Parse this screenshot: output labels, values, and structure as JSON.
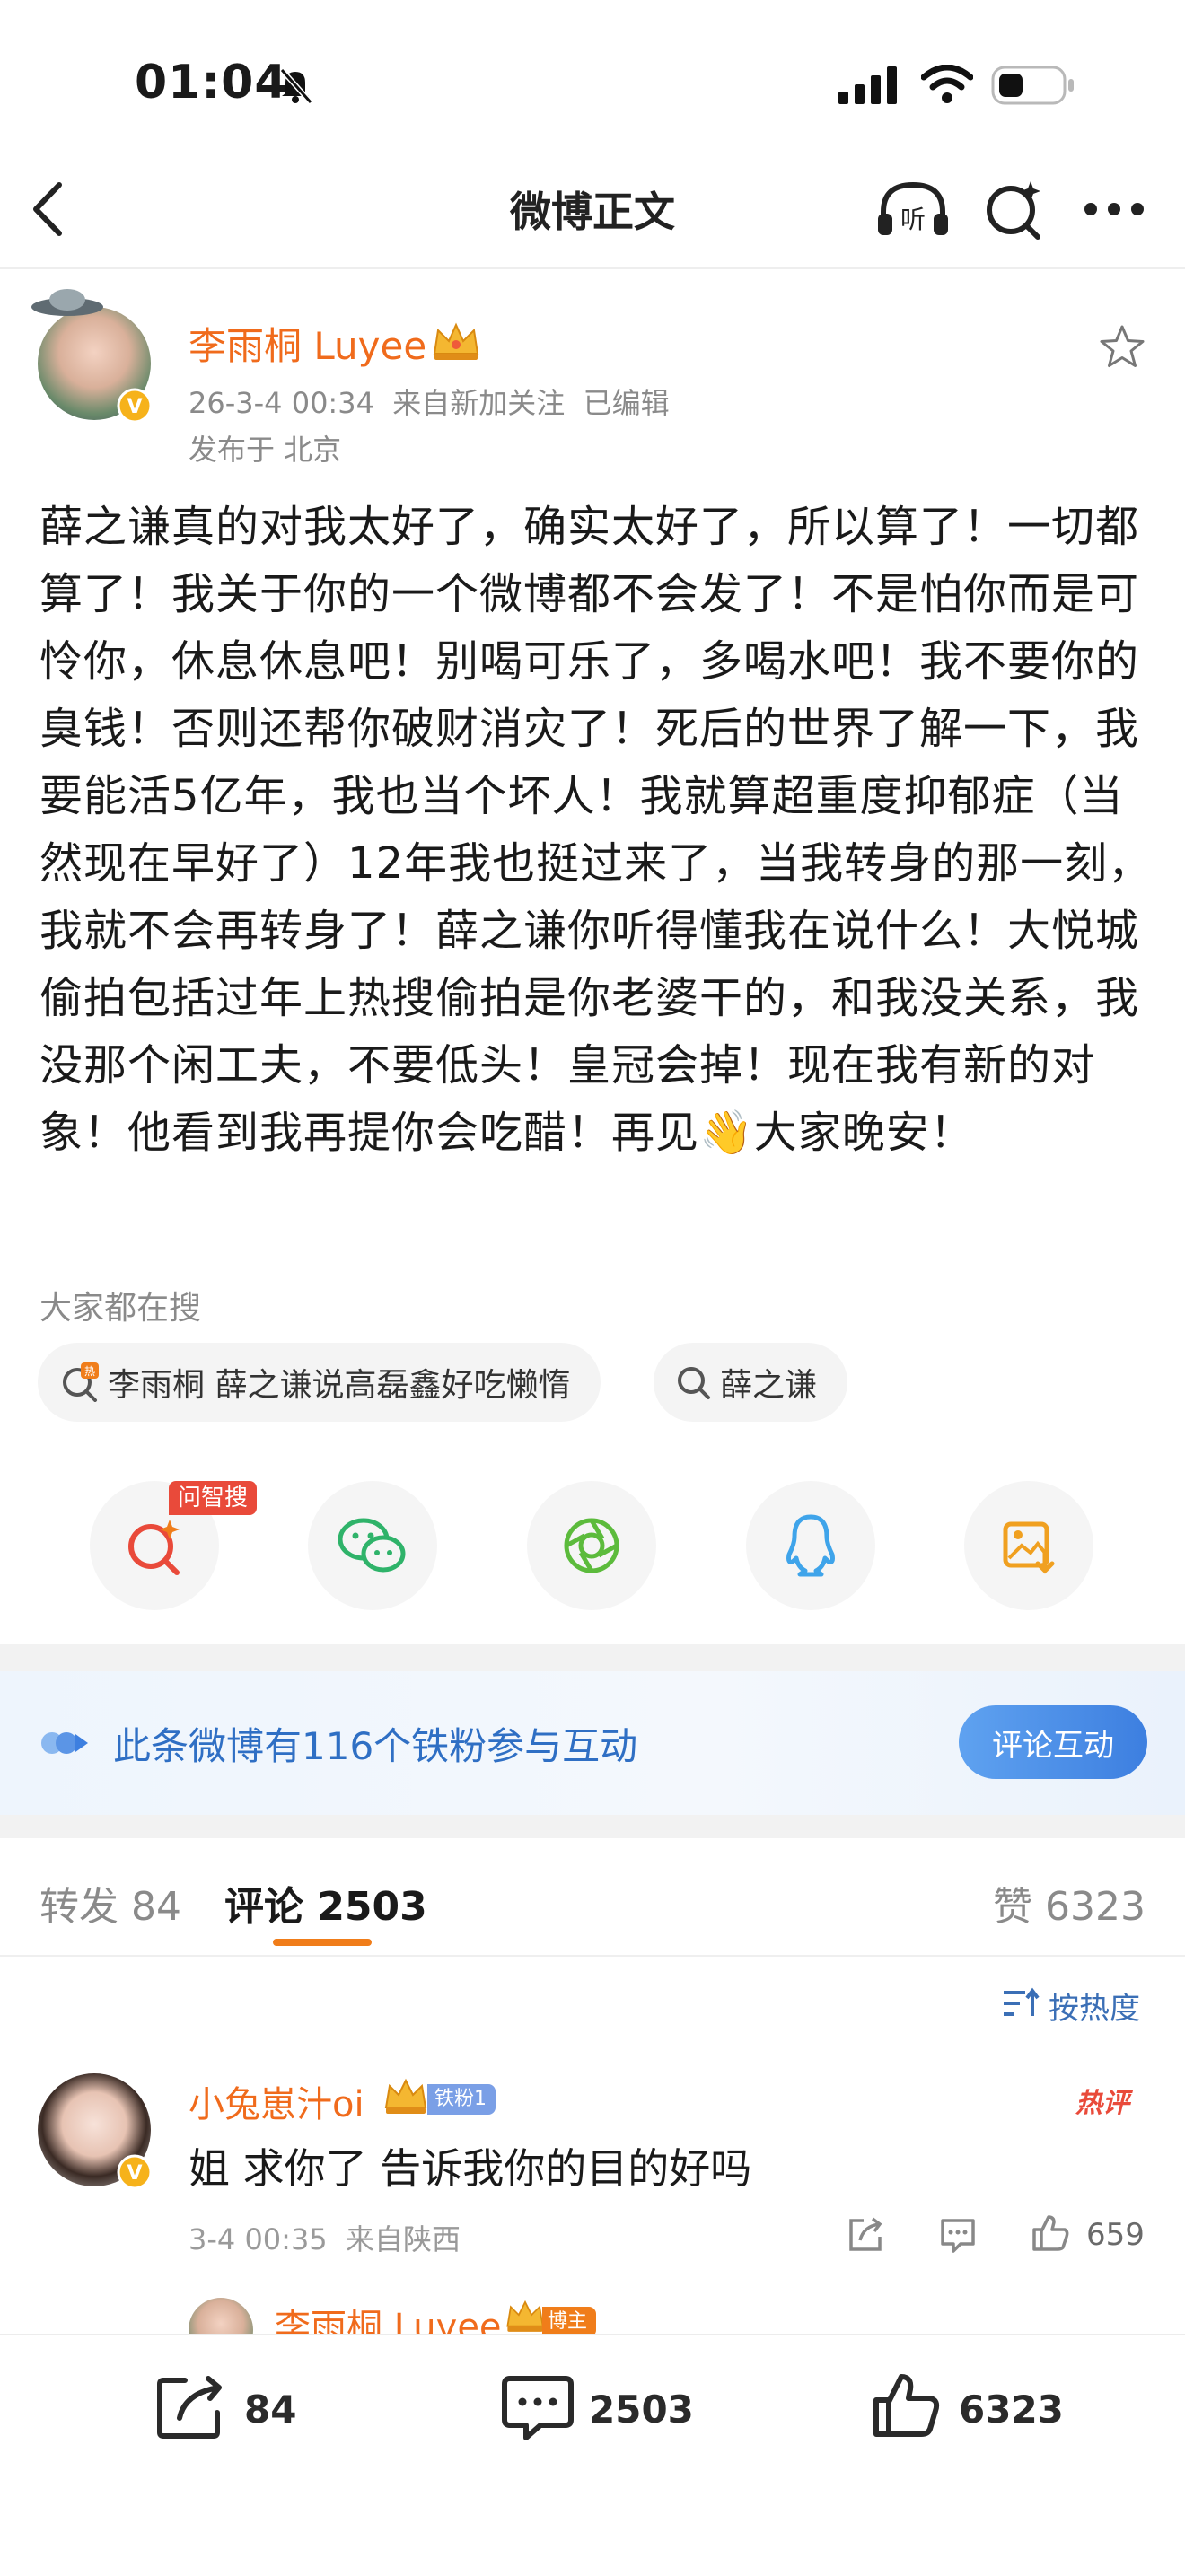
{
  "status_bar": {
    "time": "01:04"
  },
  "nav": {
    "title": "微博正文"
  },
  "post": {
    "author": "李雨桐 Luyee",
    "meta": "26-3-4 00:34  来自新加关注  已编辑",
    "location": "发布于 北京",
    "body": "薛之谦真的对我太好了，确实太好了，所以算了！一切都算了！我关于你的一个微博都不会发了！不是怕你而是可怜你，休息休息吧！别喝可乐了，多喝水吧！我不要你的臭钱！否则还帮你破财消灾了！死后的世界了解一下，我要能活5亿年，我也当个坏人！我就算超重度抑郁症（当然现在早好了）12年我也挺过来了，当我转身的那一刻，我就不会再转身了！薛之谦你听得懂我在说什么！大悦城偷拍包括过年上热搜偷拍是你老婆干的，和我没关系，我没那个闲工夫，不要低头！皇冠会掉！现在我有新的对象！他看到我再提你会吃醋！再见👋大家晚安！"
  },
  "search": {
    "heading": "大家都在搜",
    "chips": [
      "李雨桐 薛之谦说高磊鑫好吃懒惰",
      "薛之谦"
    ]
  },
  "share": {
    "ai_badge": "问智搜"
  },
  "fan_banner": {
    "text": "此条微博有116个铁粉参与互动",
    "button": "评论互动"
  },
  "tabs": {
    "reposts": "转发 84",
    "comments": "评论 2503",
    "likes": "赞 6323"
  },
  "sort": {
    "label": "按热度"
  },
  "comment": {
    "user": "小兔崽汁oi",
    "fan_tag": "铁粉1",
    "hot_tag": "热评",
    "text": "姐 求你了 告诉我你的目的好吗",
    "meta": "3-4 00:35  来自陕西",
    "likes": "659",
    "reply_user": "李雨桐 Luyee",
    "reply_tag": "博主"
  },
  "bottom": {
    "reposts": "84",
    "comments": "2503",
    "likes": "6323"
  },
  "colors": {
    "accent": "#f06b1c",
    "link": "#2f6fc4",
    "hot": "#e94a3a"
  }
}
